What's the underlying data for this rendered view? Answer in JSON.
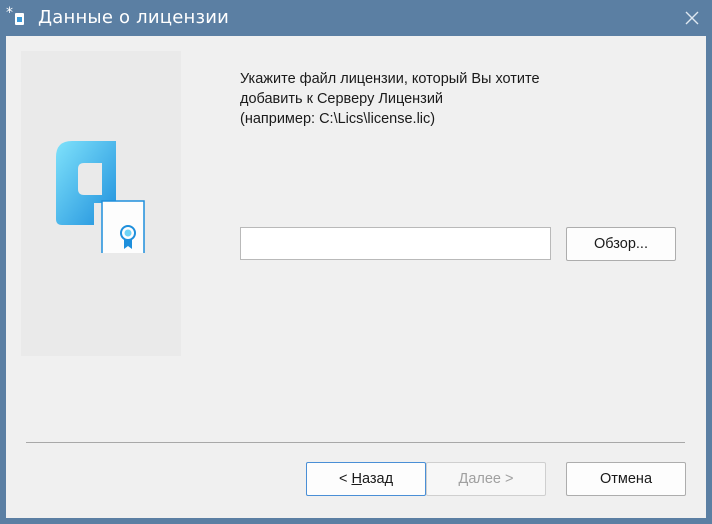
{
  "window": {
    "title": "Данные о лицензии",
    "app_icon": "license-app-icon",
    "close_icon": "close-icon"
  },
  "side_panel": {
    "logo_icon": "license-certificate-icon",
    "colors": {
      "accent": "#2aa3e6",
      "accent_light": "#7fd8f7",
      "panel": "#eaeaea"
    }
  },
  "instructions": {
    "line1": "Укажите файл лицензии, который Вы хотите",
    "line2": "добавить к Серверу Лицензий",
    "line3": "(например: C:\\Lics\\license.lic)"
  },
  "file_field": {
    "value": "",
    "placeholder": ""
  },
  "buttons": {
    "browse": "Обзор...",
    "back_prefix": "< ",
    "back_mnemonic": "Н",
    "back_rest": "азад",
    "next": "Далее >",
    "cancel": "Отмена"
  }
}
